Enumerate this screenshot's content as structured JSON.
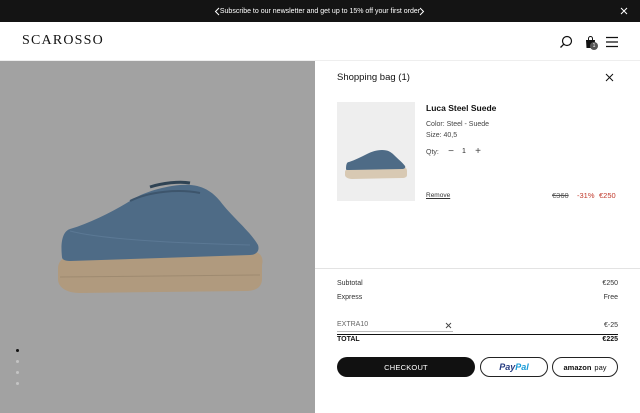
{
  "promo": {
    "text": "Subscribe to our newsletter and get up to 15% off your first order",
    "prev_icon": "chevron-left-icon",
    "next_icon": "chevron-right-icon",
    "close_icon": "close-icon"
  },
  "header": {
    "logo": "SCAROSSO",
    "icons": [
      "search-icon",
      "bag-icon",
      "menu-icon"
    ],
    "bag_count": "1"
  },
  "hero": {
    "slide_count": 4,
    "active_slide": 1,
    "background": "#a2a2a2"
  },
  "cart": {
    "title": "Shopping bag (1)",
    "item": {
      "name": "Luca Steel Suede",
      "color": "Color: Steel - Suede",
      "size": "Size: 40,5",
      "qty_label": "Qty:",
      "qty_minus": "−",
      "qty": "1",
      "qty_plus": "+",
      "remove": "Remove",
      "price_original": "€360",
      "discount": "-31%",
      "price_final": "€250"
    },
    "summary": {
      "subtotal_label": "Subtotal",
      "subtotal_value": "€250",
      "express_label": "Express",
      "express_value": "Free",
      "promo_code": "EXTRA10",
      "promo_amount": "€-25",
      "total_label": "TOTAL",
      "total_value": "€225"
    },
    "buttons": {
      "checkout": "CHECKOUT",
      "paypal_1": "Pay",
      "paypal_2": "Pal",
      "amazon_1": "amazon",
      "amazon_2": "pay"
    }
  },
  "colors": {
    "accent_sale": "#c0392b",
    "dark": "#111111",
    "paypal_dark": "#253b80",
    "paypal_light": "#179bd7"
  }
}
